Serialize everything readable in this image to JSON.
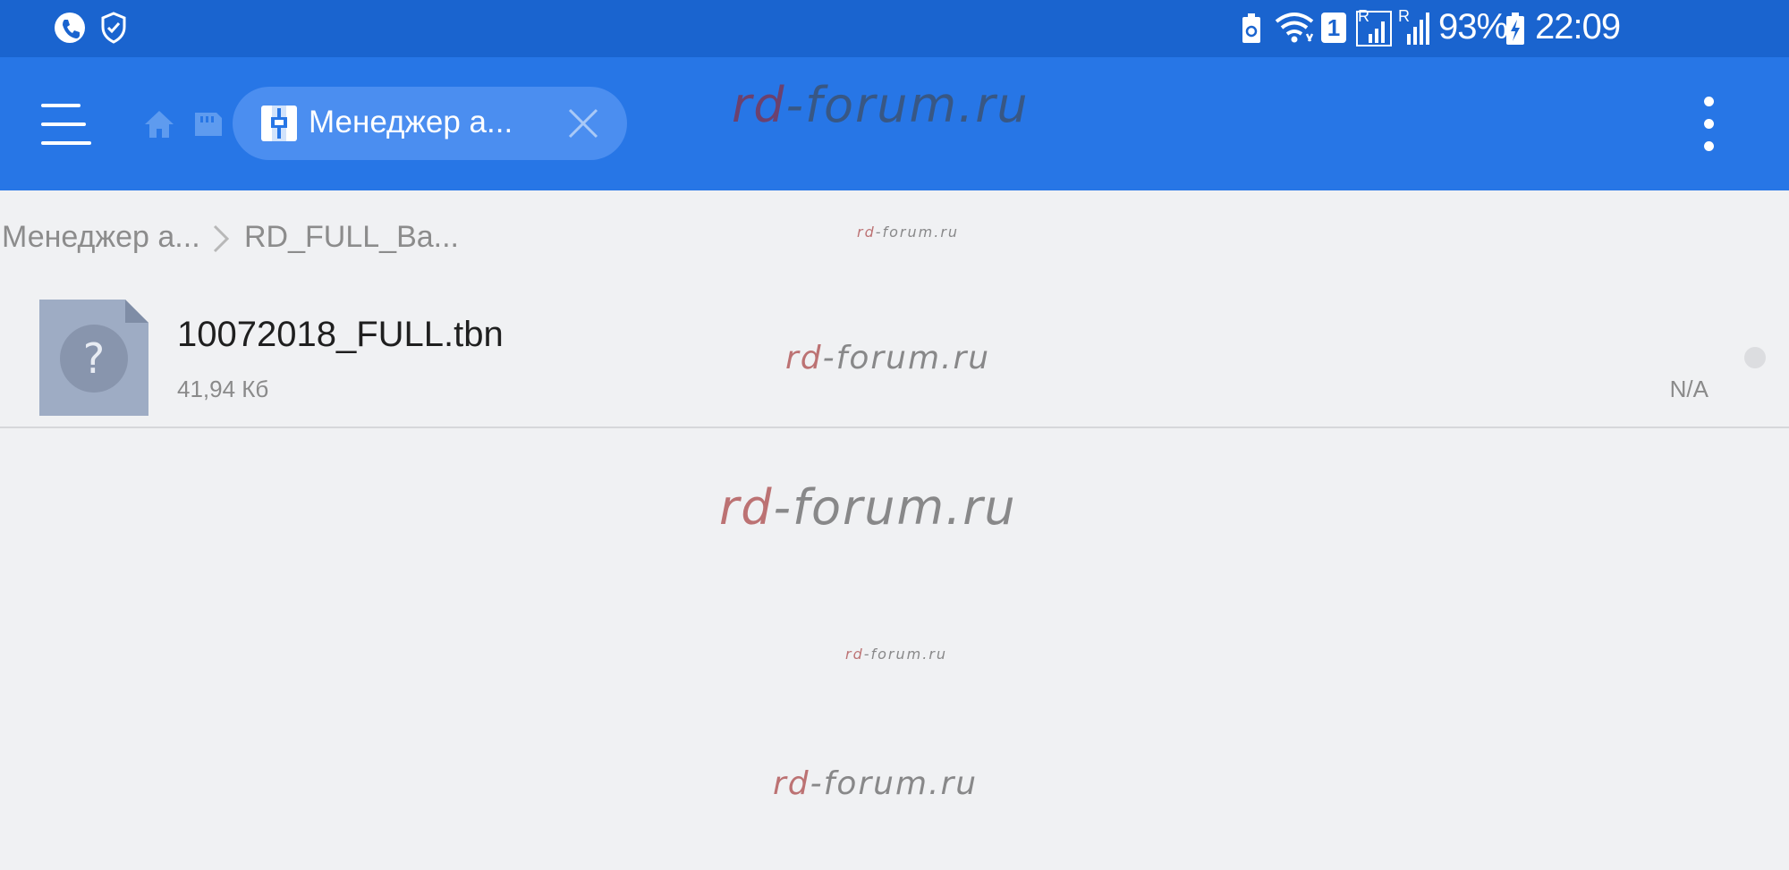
{
  "status_bar": {
    "battery_percent": "93%",
    "time": "22:09",
    "sim_badge": "1",
    "roaming_badge_1": "R",
    "roaming_badge_2": "R",
    "left_icons": [
      "phone-call-icon",
      "shield-check-icon"
    ],
    "right_icons": [
      "battery-saver-icon",
      "wifi-icon",
      "sim-1-icon",
      "signal-roaming-icon",
      "signal-icon",
      "battery-charging-icon"
    ]
  },
  "toolbar": {
    "tab_label": "Менеджер а...",
    "icons": [
      "menu-icon",
      "home-icon",
      "sd-card-icon",
      "app-manager-icon",
      "close-icon",
      "more-vert-icon"
    ]
  },
  "breadcrumb": {
    "items": [
      "Менеджер а...",
      "RD_FULL_Ba..."
    ]
  },
  "files": [
    {
      "name": "10072018_FULL.tbn",
      "size": "41,94 Кб",
      "date": "N/A",
      "icon": "unknown-file-icon"
    }
  ],
  "watermark": {
    "part1": "rd",
    "part2": "-forum.ru"
  },
  "colors": {
    "status_bar": "#1a64cf",
    "toolbar": "#2776e6",
    "tab_chip": "#4b8ef0",
    "background": "#f0f1f3",
    "file_icon": "#9eacc4"
  }
}
